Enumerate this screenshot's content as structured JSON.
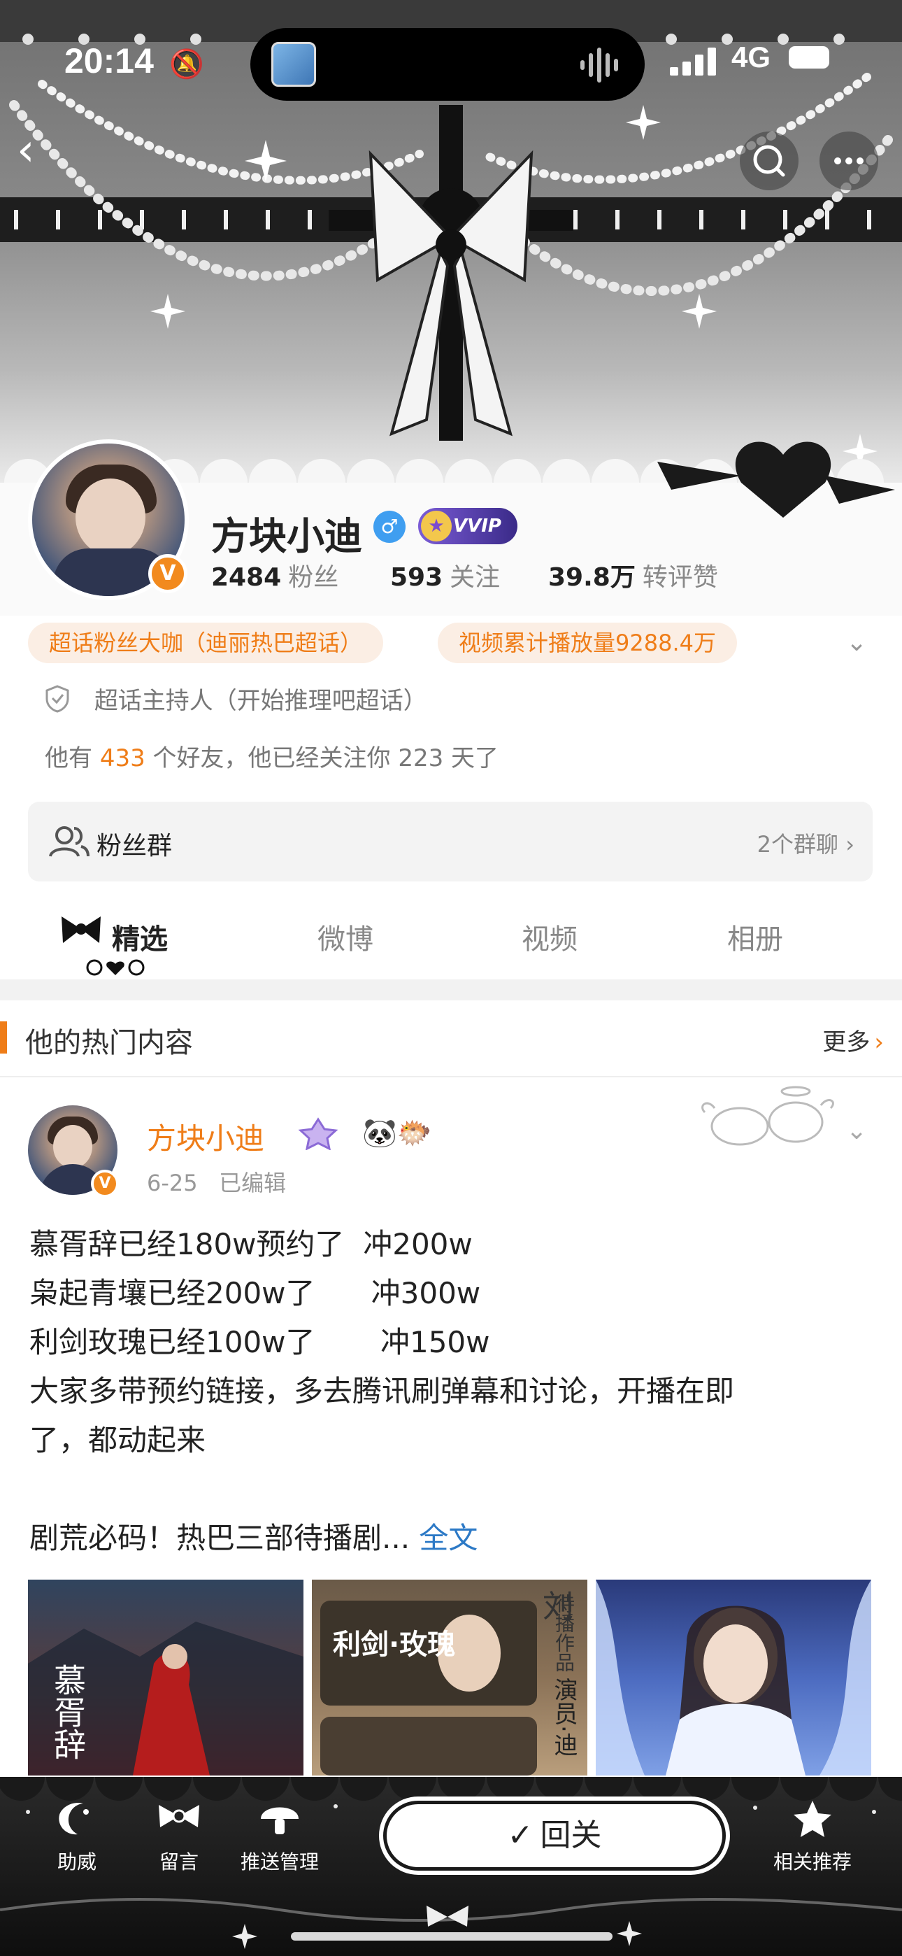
{
  "status_bar": {
    "time": "20:14",
    "network": "4G"
  },
  "profile": {
    "name": "方块小迪",
    "vip_label": "VVIP",
    "verified_mark": "V",
    "stats": [
      {
        "value": "2484",
        "label": "粉丝"
      },
      {
        "value": "593",
        "label": "关注"
      },
      {
        "value": "39.8万",
        "label": "转评赞"
      }
    ],
    "tags": [
      "超话粉丝大咖（迪丽热巴超话）",
      "视频累计播放量9288.4万"
    ],
    "host_text": "超话主持人（开始推理吧超话）",
    "friend_line": {
      "prefix": "他有 ",
      "friends": "433",
      "middle": " 个好友，他已经关注你 ",
      "days": "223",
      "suffix": " 天了"
    }
  },
  "fan_group": {
    "label": "粉丝群",
    "right": "2个群聊 ›"
  },
  "tabs": [
    "精选",
    "微博",
    "视频",
    "相册"
  ],
  "hot_section": {
    "title": "他的热门内容",
    "more": "更多",
    "more_arrow": "›"
  },
  "post": {
    "author": "方块小迪",
    "date": "6-25",
    "edited": "已编辑",
    "lines": [
      "慕胥辞已经180w预约了  冲200w",
      "枭起青壤已经200w了      冲300w",
      "利剑玫瑰已经100w了       冲150w",
      "大家多带预约链接，多去腾讯刷弹幕和讨论，开播在即",
      "了，都动起来",
      "",
      "剧荒必码！热巴三部待播剧..."
    ],
    "more_link": " 全文",
    "thumb_texts": {
      "t1": "慕胥辞",
      "t2_title": "利剑·玫瑰",
      "t2_side1": "待播作品",
      "t2_side2": "演员·迪",
      "t2_top": "刘"
    }
  },
  "bottom_bar": {
    "items": [
      "助威",
      "留言",
      "推送管理",
      "相关推荐"
    ],
    "follow_label": "回关",
    "follow_check": "✓"
  },
  "colors": {
    "accent": "#ef7d18",
    "link": "#2c79c6",
    "tag_bg": "#fbeee4"
  }
}
